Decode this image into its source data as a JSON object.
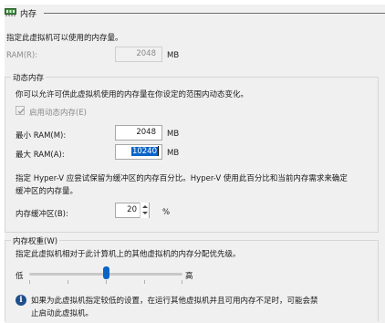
{
  "header": {
    "title": "内存",
    "icon": "memory-chip-icon"
  },
  "intro": "指定此虚拟机可以使用的内存量。",
  "ram": {
    "label": "RAM(R):",
    "value": "2048",
    "unit": "MB"
  },
  "dynamic_memory": {
    "title": "动态内存",
    "description": "你可以允许可供此虚拟机使用的内存量在你设定的范围内动态变化。",
    "enable_label": "启用动态内存(E)",
    "enabled": true,
    "min": {
      "label": "最小 RAM(M):",
      "value": "2048",
      "unit": "MB"
    },
    "max": {
      "label": "最大 RAM(A):",
      "value": "10240",
      "unit": "MB"
    },
    "buffer_description_line1": "指定 Hyper-V 应尝试保留为缓冲区的内存百分比。Hyper-V 使用此百分比和当前内存需求来确定",
    "buffer_description_line2": "缓冲区的内存量。",
    "buffer": {
      "label": "内存缓冲区(B):",
      "value": "20",
      "unit": "%"
    }
  },
  "memory_weight": {
    "title": "内存权重(W)",
    "description": "指定此虚拟机相对于此计算机上的其他虚拟机的内存分配优先级。",
    "low_label": "低",
    "high_label": "高",
    "slider_level": 0.5,
    "info_icon": "info-icon",
    "info_line1": "如果为此虚拟机指定较低的设置，在运行其他虚拟机并且可用内存不足时，可能会禁",
    "info_line2": "止启动此虚拟机。"
  },
  "colors": {
    "accent": "#0a64c8",
    "info": "#1f4e8c"
  }
}
